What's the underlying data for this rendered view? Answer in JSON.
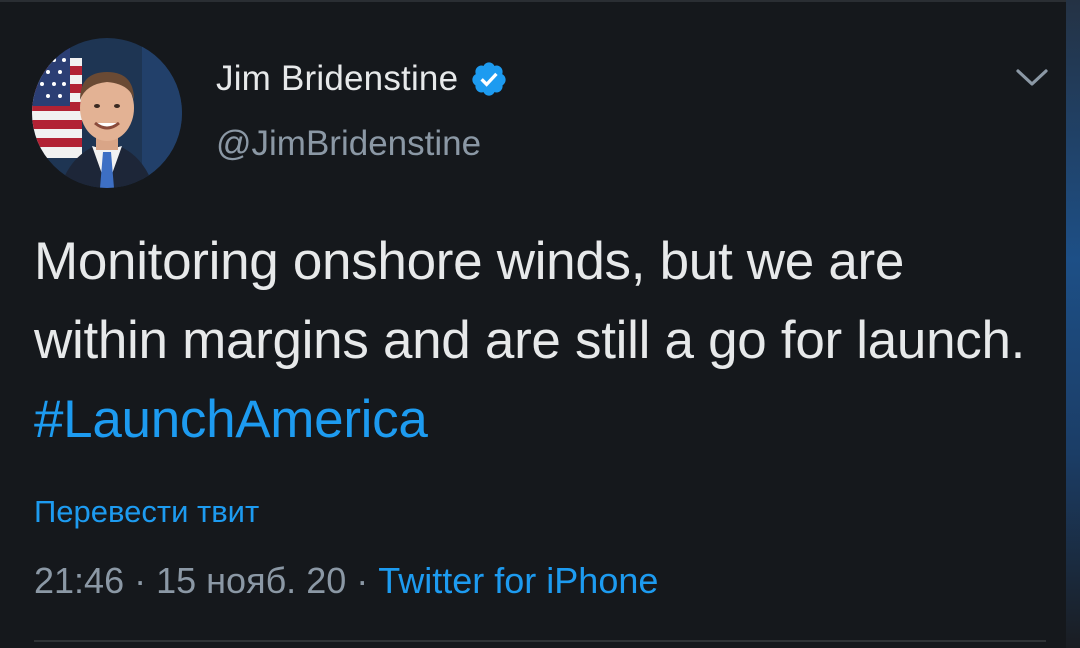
{
  "colors": {
    "background": "#15181c",
    "primary_text": "#e7e9ea",
    "secondary_text": "#8b98a5",
    "accent": "#1d9bf0",
    "divider": "#2f3336"
  },
  "tweet": {
    "author": {
      "display_name": "Jim Bridenstine",
      "handle": "@JimBridenstine",
      "verified": true,
      "avatar_icon": "profile-photo"
    },
    "menu_icon": "chevron-down-icon",
    "text_before_hashtag": "Monitoring onshore winds, but we are within margins and are still a go for launch. ",
    "hashtag": "#LaunchAmerica",
    "translate_label": "Перевести твит",
    "time": "21:46",
    "date": "15 нояб. 20",
    "separator": "·",
    "source": "Twitter for iPhone"
  }
}
